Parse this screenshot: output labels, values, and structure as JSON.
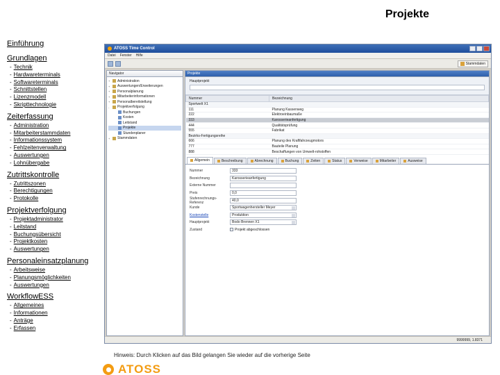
{
  "page": {
    "title": "Projekte"
  },
  "nav": {
    "intro": "Einführung",
    "sections": [
      {
        "title": "Grundlagen",
        "items": [
          "Technik",
          "Hardwareterminals",
          "Softwareterminals",
          "Schnittstellen",
          "Lizenzmodell",
          "Skripttechnologie"
        ]
      },
      {
        "title": "Zeiterfassung",
        "items": [
          "Administration",
          "Mitarbeiterstammdaten",
          "Informationssystem",
          "Fehlzeitenverwaltung",
          "Auswertungen",
          "Lohnübergabe"
        ]
      },
      {
        "title": "Zutrittskontrolle",
        "items": [
          "Zutrittszonen",
          "Berechtigungen",
          "Protokolle"
        ]
      },
      {
        "title": "Projektverfolgung",
        "items": [
          "Projektadministrator",
          "Leitstand",
          "Buchungsübersicht",
          "Projektkosten",
          "Auswertungen"
        ]
      },
      {
        "title": "Personaleinsatzplanung",
        "items": [
          "Arbeitsweise",
          "Planungsmöglichkeiten",
          "Auswertungen"
        ]
      },
      {
        "title": "WorkflowESS",
        "items": [
          "Allgemeines",
          "Informationen",
          "Anträge",
          "Erfassen"
        ]
      }
    ]
  },
  "app": {
    "window_title": "ATOSS Time Control",
    "menu": [
      "Datei",
      "Fenster",
      "Hilfe"
    ],
    "perspective": "Stammdaten",
    "left_tab": "Navigator",
    "right_tab": "Projekte",
    "tree": [
      {
        "label": "Administration",
        "level": 0,
        "expand": "+"
      },
      {
        "label": "Auswertungen/Erweiterungen",
        "level": 0,
        "expand": "+"
      },
      {
        "label": "Personalplanung",
        "level": 0,
        "expand": "+"
      },
      {
        "label": "Mitarbeiterinformationen",
        "level": 0,
        "expand": "+"
      },
      {
        "label": "Personalbereitstellung",
        "level": 0,
        "expand": "+"
      },
      {
        "label": "Projektverfolgung",
        "level": 0,
        "expand": "-"
      },
      {
        "label": "Buchungen",
        "level": 1,
        "expand": ""
      },
      {
        "label": "Kosten",
        "level": 1,
        "expand": ""
      },
      {
        "label": "Leitstand",
        "level": 1,
        "expand": ""
      },
      {
        "label": "Projekte",
        "level": 1,
        "expand": "",
        "selected": true
      },
      {
        "label": "Stundenplaner",
        "level": 1,
        "expand": ""
      },
      {
        "label": "Stammdaten",
        "level": 0,
        "expand": "+"
      }
    ],
    "main_project_label": "Hauptprojekt",
    "grid_headers": [
      "Nummer",
      "Bezeichnung"
    ],
    "grid_rows": [
      {
        "group": true,
        "num": "Sportwelt X1",
        "name": ""
      },
      {
        "num": "111",
        "name": "Planung Kassenweg"
      },
      {
        "num": "222",
        "name": "Elektroeinbaumaße"
      },
      {
        "num": "333",
        "name": "Karosserieanfertigung",
        "selected": true
      },
      {
        "num": "444",
        "name": "Qualitätsprüfung"
      },
      {
        "num": "555",
        "name": "Fabrikat"
      },
      {
        "group": true,
        "num": "Bezirks-Fertigungsreihe",
        "name": ""
      },
      {
        "num": "666",
        "name": "Planung des Kraftfahrzeugmotors"
      },
      {
        "num": "777",
        "name": "Bauteile Planung"
      },
      {
        "num": "888",
        "name": "Beschaffungen von Umwelt-rohstoffen"
      }
    ],
    "detail_tabs": [
      "Allgemein",
      "Beschreibung",
      "Abrechnung",
      "Buchung",
      "Zeiten",
      "Status",
      "Verweise",
      "Mitarbeiter",
      "Ausweise"
    ],
    "fields": [
      {
        "label": "Nummer",
        "value": "333",
        "type": "text"
      },
      {
        "label": "Bezeichnung",
        "value": "Karosserieanfertigung",
        "type": "text"
      },
      {
        "label": "Externe Nummer",
        "value": "",
        "type": "text"
      },
      {
        "label": "Preis",
        "value": "0,0",
        "type": "text"
      },
      {
        "label": "Stufenrechnungs-Referenz",
        "value": "40,0",
        "type": "text"
      },
      {
        "label": "Kunde",
        "value": "Sportwagenhersteller Meyer",
        "type": "combo"
      },
      {
        "label": "Kostenstelle",
        "value": "Produktion",
        "type": "combo",
        "link": true
      },
      {
        "label": "Hauptprojekt",
        "value": "Bodo Brennen X1",
        "type": "combo"
      },
      {
        "label": "Zustand",
        "value": "Projekt abgeschlossen",
        "type": "check"
      }
    ],
    "status_text": "9999999, 1.8371"
  },
  "footer": {
    "hint": "Hinweis: Durch Klicken auf das Bild gelangen Sie wieder auf die vorherige Seite",
    "brand": "ATOSS",
    "brand_color": "#f39c12"
  }
}
